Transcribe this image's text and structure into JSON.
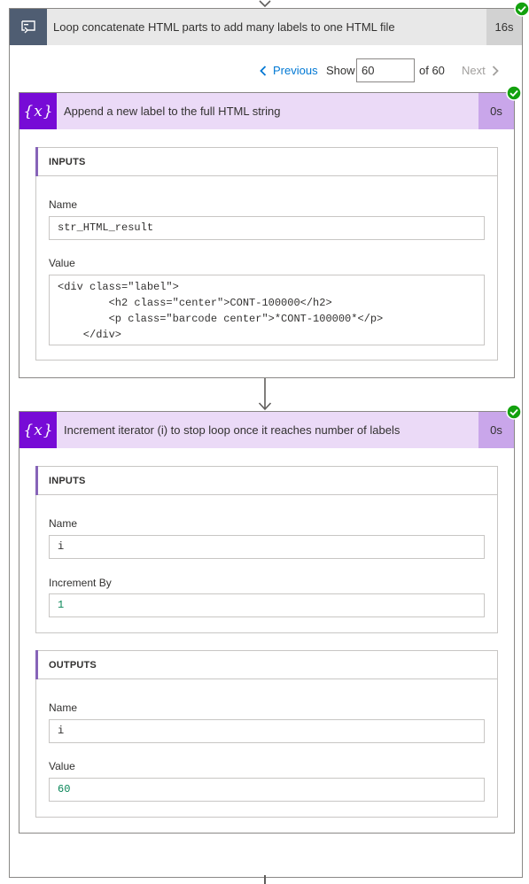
{
  "loop": {
    "title": "Loop concatenate HTML parts to add many labels to one HTML file",
    "duration": "16s",
    "icon": "loop-icon",
    "status": "succeeded"
  },
  "pager": {
    "previous_label": "Previous",
    "show_label": "Show",
    "current_value": "60",
    "of_label": "of 60",
    "next_label": "Next"
  },
  "actions": [
    {
      "title": "Append a new label to the full HTML string",
      "duration": "0s",
      "icon": "variable-icon",
      "status": "succeeded",
      "inputs": {
        "header": "INPUTS",
        "fields": [
          {
            "label": "Name",
            "value": "str_HTML_result"
          },
          {
            "label": "Value",
            "value": "<div class=\"label\">\n        <h2 class=\"center\">CONT-100000</h2>\n        <p class=\"barcode center\">*CONT-100000*</p>\n    </div>"
          }
        ]
      }
    },
    {
      "title": "Increment iterator (i) to stop loop once it reaches number of labels",
      "duration": "0s",
      "icon": "variable-icon",
      "status": "succeeded",
      "inputs": {
        "header": "INPUTS",
        "fields": [
          {
            "label": "Name",
            "value": "i"
          },
          {
            "label": "Increment By",
            "value": "1"
          }
        ]
      },
      "outputs": {
        "header": "OUTPUTS",
        "fields": [
          {
            "label": "Name",
            "value": "i"
          },
          {
            "label": "Value",
            "value": "60"
          }
        ]
      }
    }
  ],
  "colors": {
    "accent_link": "#0078d4",
    "variable_icon_bg": "#770bd6",
    "variable_header_bg": "#ebdaf7",
    "success_green": "#13a10e",
    "loop_icon_bg": "#4f5d72"
  }
}
